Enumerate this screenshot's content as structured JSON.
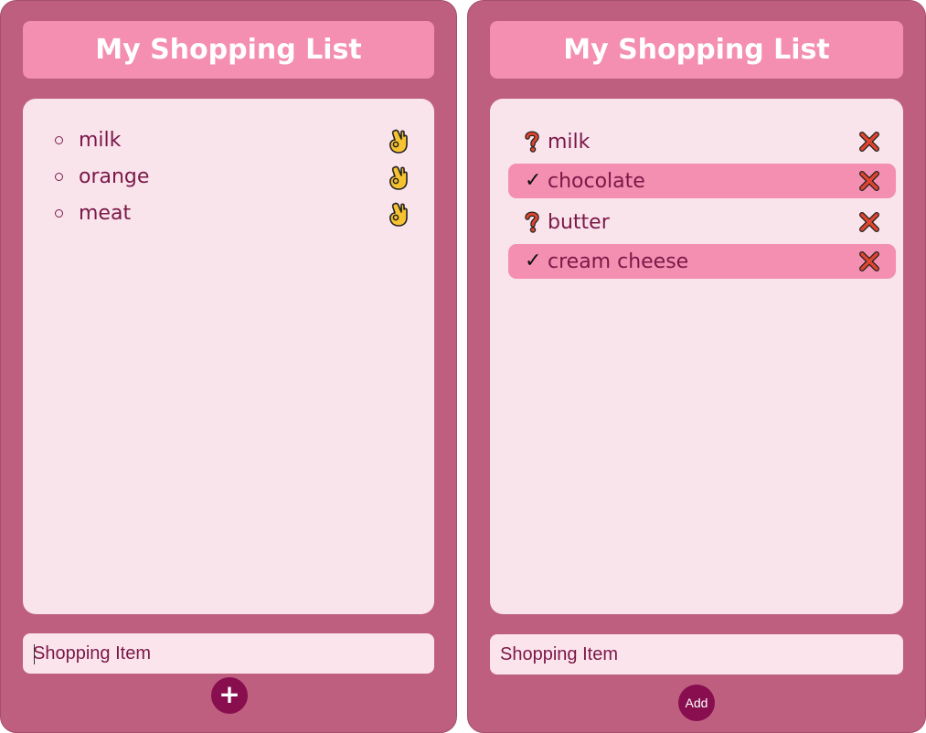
{
  "left_panel": {
    "title": "My Shopping List",
    "items": [
      {
        "label": "milk",
        "icon": "ok-hand-icon"
      },
      {
        "label": "orange",
        "icon": "ok-hand-icon"
      },
      {
        "label": "meat",
        "icon": "ok-hand-icon"
      }
    ],
    "input_placeholder": "Shopping Item",
    "add_button_label": "+"
  },
  "right_panel": {
    "title": "My Shopping List",
    "items": [
      {
        "label": "milk",
        "status": "pending",
        "status_icon": "question-mark-icon",
        "delete_icon": "cross-mark-icon"
      },
      {
        "label": "chocolate",
        "status": "done",
        "status_icon": "check-icon",
        "delete_icon": "cross-mark-icon"
      },
      {
        "label": "butter",
        "status": "pending",
        "status_icon": "question-mark-icon",
        "delete_icon": "cross-mark-icon"
      },
      {
        "label": "cream cheese",
        "status": "done",
        "status_icon": "check-icon",
        "delete_icon": "cross-mark-icon"
      }
    ],
    "check_glyph": "✓",
    "input_placeholder": "Shopping Item",
    "add_button_label": "Add"
  },
  "colors": {
    "panel_bg": "#bf5f80",
    "title_bg": "#f48fb1",
    "card_bg": "#fae4ec",
    "done_row_bg": "#f48fb1",
    "text": "#7a1848",
    "button_bg": "#880e4f"
  }
}
